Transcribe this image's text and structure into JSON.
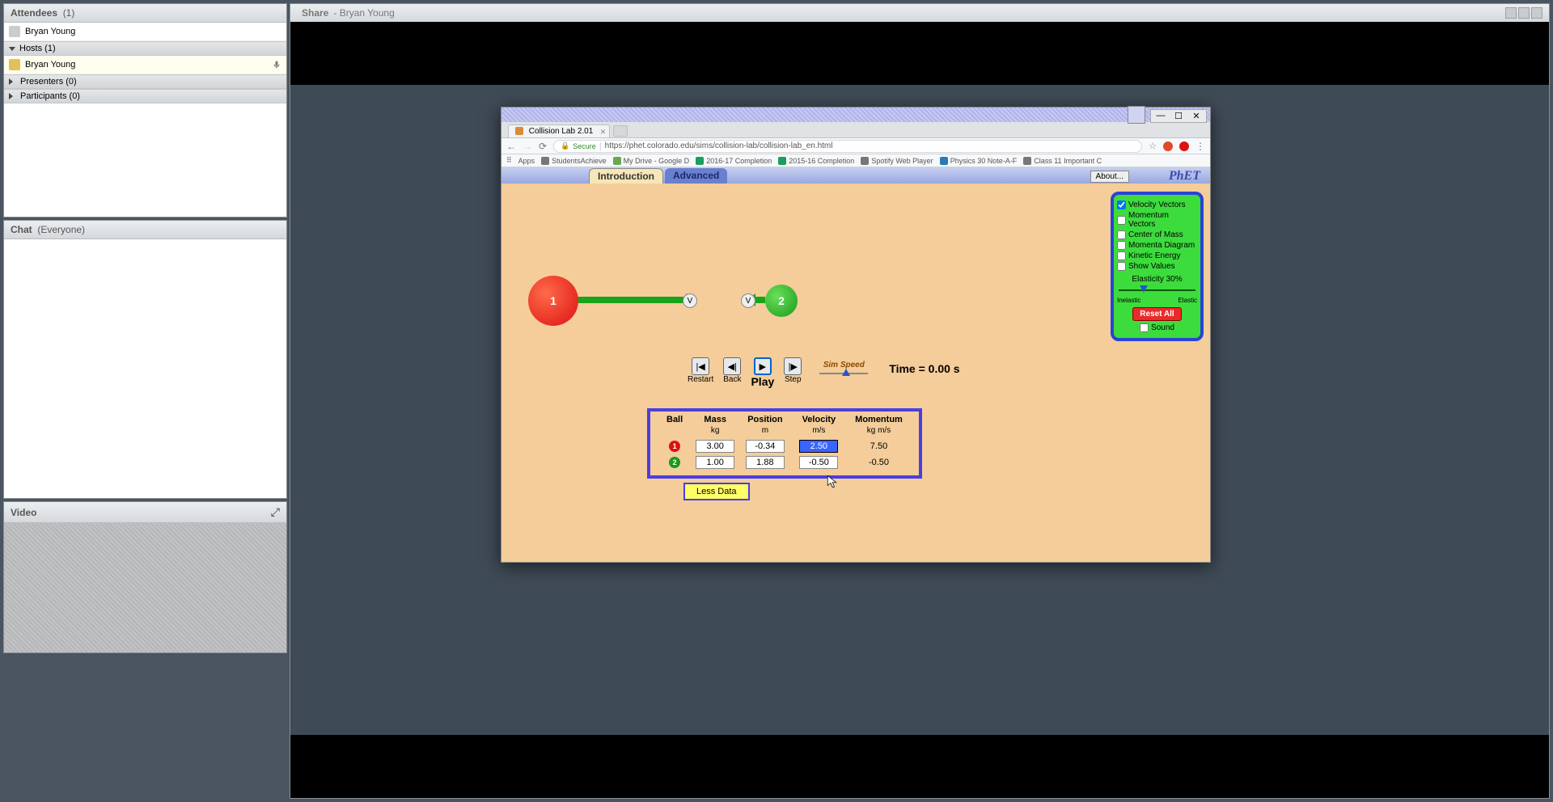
{
  "attendees": {
    "title": "Attendees",
    "count": "(1)",
    "self": "Bryan Young",
    "hosts_label": "Hosts (1)",
    "host_name": "Bryan Young",
    "presenters_label": "Presenters (0)",
    "participants_label": "Participants (0)"
  },
  "chat": {
    "title": "Chat",
    "scope": "(Everyone)"
  },
  "video": {
    "title": "Video"
  },
  "share": {
    "title": "Share",
    "presenter": "- Bryan Young"
  },
  "browser": {
    "tab_title": "Collision Lab 2.01",
    "secure": "Secure",
    "url": "https://phet.colorado.edu/sims/collision-lab/collision-lab_en.html",
    "bookmarks": [
      "Apps",
      "StudentsAchieve",
      "My Drive - Google D",
      "2016-17 Completion",
      "2015-16 Completion",
      "Spotify Web Player",
      "Physics 30 Note-A-F",
      "Class 11 Important C"
    ]
  },
  "sim": {
    "tab_intro": "Introduction",
    "tab_adv": "Advanced",
    "about": "About...",
    "brand": "PhET",
    "balls": {
      "b1": "1",
      "b2": "2"
    },
    "controls": {
      "restart": "Restart",
      "back": "Back",
      "play": "Play",
      "step": "Step",
      "simspeed": "Sim Speed",
      "time": "Time = 0.00 s"
    },
    "options": {
      "velocity": "Velocity Vectors",
      "momentum_v": "Momentum Vectors",
      "com": "Center of Mass",
      "md": "Momenta Diagram",
      "ke": "Kinetic Energy",
      "sv": "Show Values",
      "elasticity": "Elasticity 30%",
      "inelastic": "Inelastic",
      "elastic": "Elastic",
      "reset": "Reset All",
      "sound": "Sound"
    },
    "table": {
      "h_ball": "Ball",
      "h_mass": "Mass",
      "h_pos": "Position",
      "h_vel": "Velocity",
      "h_mom": "Momentum",
      "u_mass": "kg",
      "u_pos": "m",
      "u_vel": "m/s",
      "u_mom": "kg m/s",
      "r1": {
        "mass": "3.00",
        "pos": "-0.34",
        "vel": "2.50",
        "mom": "7.50"
      },
      "r2": {
        "mass": "1.00",
        "pos": "1.88",
        "vel": "-0.50",
        "mom": "-0.50"
      },
      "less": "Less Data"
    }
  }
}
